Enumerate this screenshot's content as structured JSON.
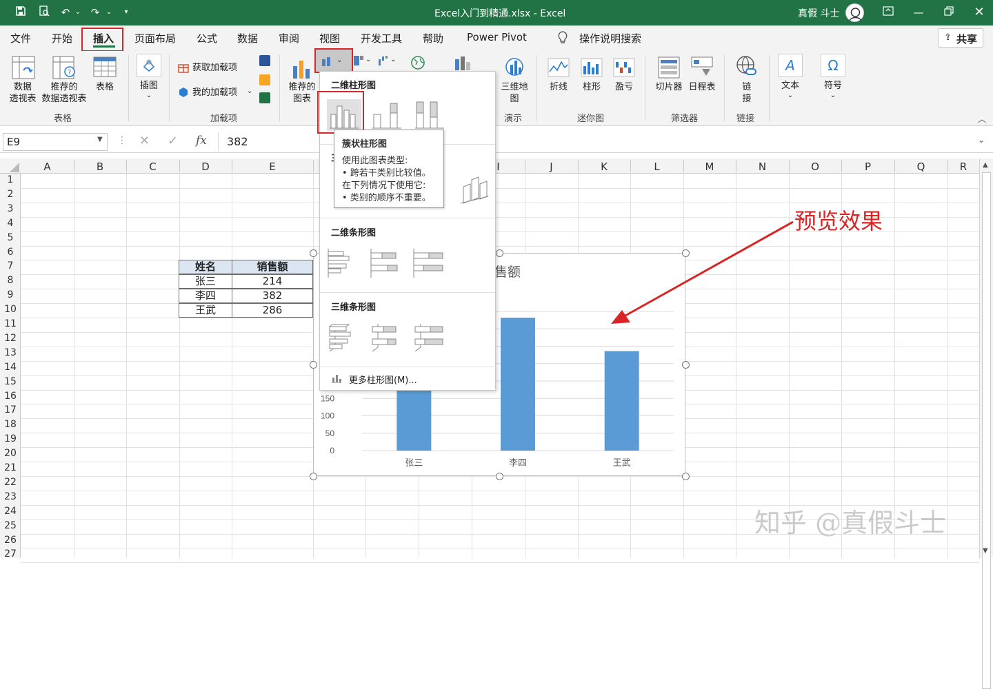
{
  "titlebar": {
    "title": "Excel入门到精通.xlsx  -  Excel",
    "user": "真假 斗士",
    "colors": {
      "bg": "#217346"
    }
  },
  "menu": {
    "items": [
      "文件",
      "开始",
      "插入",
      "页面布局",
      "公式",
      "数据",
      "审阅",
      "视图",
      "开发工具",
      "帮助",
      "Power Pivot"
    ],
    "active": "插入",
    "tell_me": "操作说明搜索",
    "share": "共享"
  },
  "ribbon": {
    "pivot_table": "数据\n透视表",
    "recommended_pivot": "推荐的\n数据透视表",
    "table": "表格",
    "illustrations": "插图",
    "get_addins": "获取加载项",
    "my_addins": "我的加载项",
    "recommended_charts": "推荐的\n图表",
    "map_3d": "三维地\n图",
    "line": "折线",
    "column": "柱形",
    "win_loss": "盈亏",
    "slicer": "切片器",
    "timeline": "日程表",
    "link": "链\n接",
    "text": "文本",
    "symbol": "符号",
    "groups": {
      "tables": "表格",
      "addins": "加载项",
      "tours": "演示",
      "sparklines": "迷你图",
      "filters": "筛选器",
      "links": "链接"
    }
  },
  "formula_bar": {
    "name_box": "E9",
    "fx": "fx",
    "value": "382"
  },
  "sheet": {
    "columns": [
      "A",
      "B",
      "C",
      "D",
      "E",
      "F",
      "G",
      "H",
      "I",
      "J",
      "K",
      "L",
      "M",
      "N",
      "O",
      "P",
      "Q",
      "R"
    ],
    "rows": [
      "1",
      "2",
      "3",
      "4",
      "5",
      "6",
      "7",
      "8",
      "9",
      "10",
      "11",
      "12",
      "13",
      "14",
      "15",
      "16",
      "17",
      "18",
      "19",
      "20",
      "21",
      "22",
      "23",
      "24",
      "25",
      "26",
      "27"
    ],
    "table": {
      "headers": [
        "姓名",
        "销售额"
      ],
      "rows": [
        [
          "张三",
          "214"
        ],
        [
          "李四",
          "382"
        ],
        [
          "王武",
          "286"
        ]
      ]
    }
  },
  "dropdown": {
    "section_2d_column": "二维柱形图",
    "section_2d_bar": "二维条形图",
    "section_3d_bar": "三维条形图",
    "more": "更多柱形图(M)..."
  },
  "tooltip": {
    "title": "簇状柱形图",
    "lines": [
      "使用此图表类型:",
      "• 跨若干类别比较值。",
      "在下列情况下使用它:",
      "• 类别的顺序不重要。"
    ]
  },
  "annotation": {
    "text": "预览效果",
    "color": "#d92525"
  },
  "watermark": "知乎 @真假斗士",
  "chart_data": {
    "type": "bar",
    "title": "售额",
    "categories": [
      "张三",
      "李四",
      "王武"
    ],
    "values": [
      214,
      382,
      286
    ],
    "yticks": [
      0,
      50,
      100,
      150
    ],
    "ylim": [
      0,
      400
    ],
    "color": "#5b9bd5"
  }
}
